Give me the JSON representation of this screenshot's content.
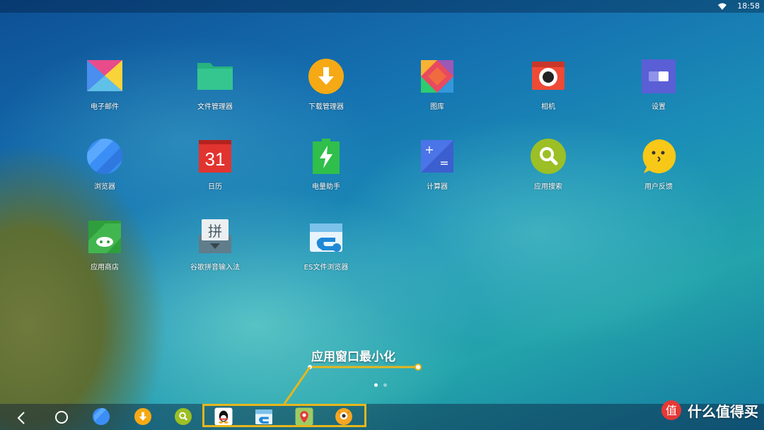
{
  "status": {
    "time": "18:58"
  },
  "apps": [
    {
      "label": "电子邮件"
    },
    {
      "label": "文件管理器"
    },
    {
      "label": "下载管理器"
    },
    {
      "label": "图库"
    },
    {
      "label": "相机"
    },
    {
      "label": "设置"
    },
    {
      "label": "浏览器"
    },
    {
      "label": "日历",
      "day": "31"
    },
    {
      "label": "电量助手"
    },
    {
      "label": "计算器"
    },
    {
      "label": "应用搜索"
    },
    {
      "label": "用户反馈"
    },
    {
      "label": "应用商店"
    },
    {
      "label": "谷歌拼音输入法",
      "glyph": "拼"
    },
    {
      "label": "ES文件浏览器"
    }
  ],
  "annotation": {
    "text": "应用窗口最小化"
  },
  "page_indicator": {
    "pages": 2,
    "active": 1
  },
  "taskbar": {
    "nav": [
      "back",
      "home"
    ],
    "pinned": [
      "browser-icon",
      "download-icon",
      "search-icon"
    ],
    "minimized": [
      "qq-icon",
      "es-explorer-icon",
      "baidu-map-icon",
      "owl-app-icon"
    ]
  },
  "watermark": {
    "text": "什么值得买",
    "badge": "值"
  },
  "colors": {
    "highlight": "#e7b61c",
    "annotation": "#ffffff"
  }
}
